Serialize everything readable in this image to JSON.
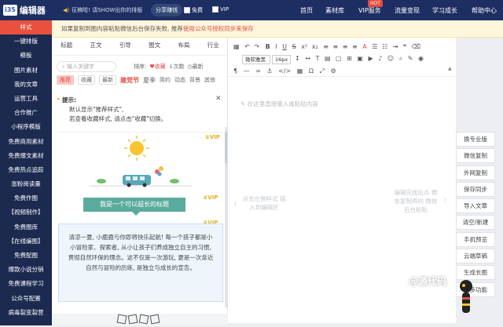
{
  "app": {
    "logo_badge": "i35",
    "title": "编辑器"
  },
  "topbar": {
    "notice": "征稿啦! 请SHOW出你的排版",
    "share_button": "分享赚钱",
    "free_label": "免费",
    "vip_label": "VIP",
    "nav": [
      "首页",
      "素材库",
      "VIP服务",
      "流量变现",
      "学习成长",
      "帮助中心"
    ],
    "badge": "HOT"
  },
  "leftnav": {
    "items": [
      "样式",
      "一键排版",
      "模板",
      "图片素材",
      "我的文章",
      "运营工具",
      "合作推广",
      "小程序模版",
      "免费商用素材",
      "免费爆文素材",
      "免费热点追踪",
      "涨粉阅读量",
      "免费作图",
      "【视频制作】",
      "免费图库",
      "【在线编图】",
      "免费配图",
      "爆款小说分销",
      "免费课程学习",
      "公众号配置",
      "病毒裂变裂营"
    ]
  },
  "warning": {
    "text": "如果复制到图内容粘贴微信后台保存失败, 推荐",
    "link": "使用公众号授权同步来保存"
  },
  "panel": {
    "tabs": [
      "标题",
      "正文",
      "引导",
      "图文",
      "布局",
      "行业"
    ],
    "search_placeholder": "输入关键字",
    "sort_label": "排序:",
    "sort_options": [
      "收藏",
      "次数",
      "最新"
    ],
    "subtabs": {
      "recommended": "推荐",
      "favorite": "收藏",
      "latest": "最新",
      "festival": "建党节",
      "others": [
        "夏季",
        "简约",
        "动态",
        "背景",
        "其他"
      ]
    },
    "tip": {
      "title": "提示:",
      "line1": "默认显示\"推荐样式\",",
      "line2": "若查看收藏样式, 请点击\"收藏\"切换。"
    },
    "vip_tag": "VIP",
    "banner_text": "我是一个可以超长的标题",
    "paragraph": "清凉一夏, 小鹿鹿与你即将快乐起航! 每一个孩子都是小小冒险家、探索者, 从小让孩子们养成独立自主的习惯, 贯彻自然环保的理念。这不仅是一次游玩, 更是一次亲近自然与冒险的历练, 是独立与成长的宣告。"
  },
  "editor": {
    "font_select": "微软雅黑",
    "size_select": "16px",
    "placeholder": "在这里直接输入或粘贴内容",
    "hint_left": "点击左侧样式 插入到编辑区",
    "hint_right": "编辑完成后点 微信复制再向 微信后台粘贴"
  },
  "rightbar": {
    "buttons": [
      "换专业版",
      "微信复制",
      "外网复制",
      "保存同步",
      "导入文章",
      "清空/新建",
      "手机预览",
      "云端草稿",
      "生成长图",
      "更多功能"
    ]
  },
  "watermark": "@源代码",
  "colors": {
    "topbar": "#1d2e62",
    "leftnav": "#1c2a50",
    "accent": "#e9503d",
    "banner": "#5bab9c"
  }
}
